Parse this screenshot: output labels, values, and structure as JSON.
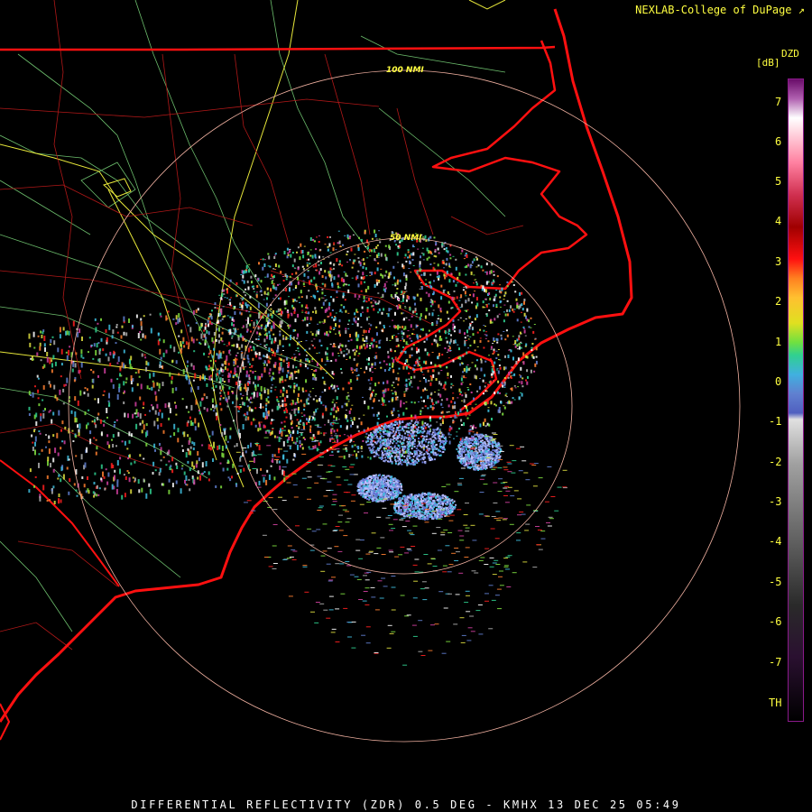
{
  "credit": "NEXLAB-College of DuPage",
  "footer": "DIFFERENTIAL REFLECTIVITY (ZDR) 0.5 DEG - KMHX 13 DEC 25 05:49",
  "legend": {
    "product": "DZD",
    "unit": "[dB]",
    "ticks": [
      "7",
      "6",
      "5",
      "4",
      "3",
      "2",
      "1",
      "0",
      "-1",
      "-2",
      "-3",
      "-4",
      "-5",
      "-6",
      "-7",
      "TH"
    ]
  },
  "range_rings": {
    "inner": "50 NMI",
    "outer": "100 NMI"
  },
  "colors": {
    "state_border": "#ff1010",
    "county_border": "#b01818",
    "highways": "#ffff40",
    "roads": "#80e080",
    "ring": "#f0b0a0",
    "text": "#ffff40"
  }
}
